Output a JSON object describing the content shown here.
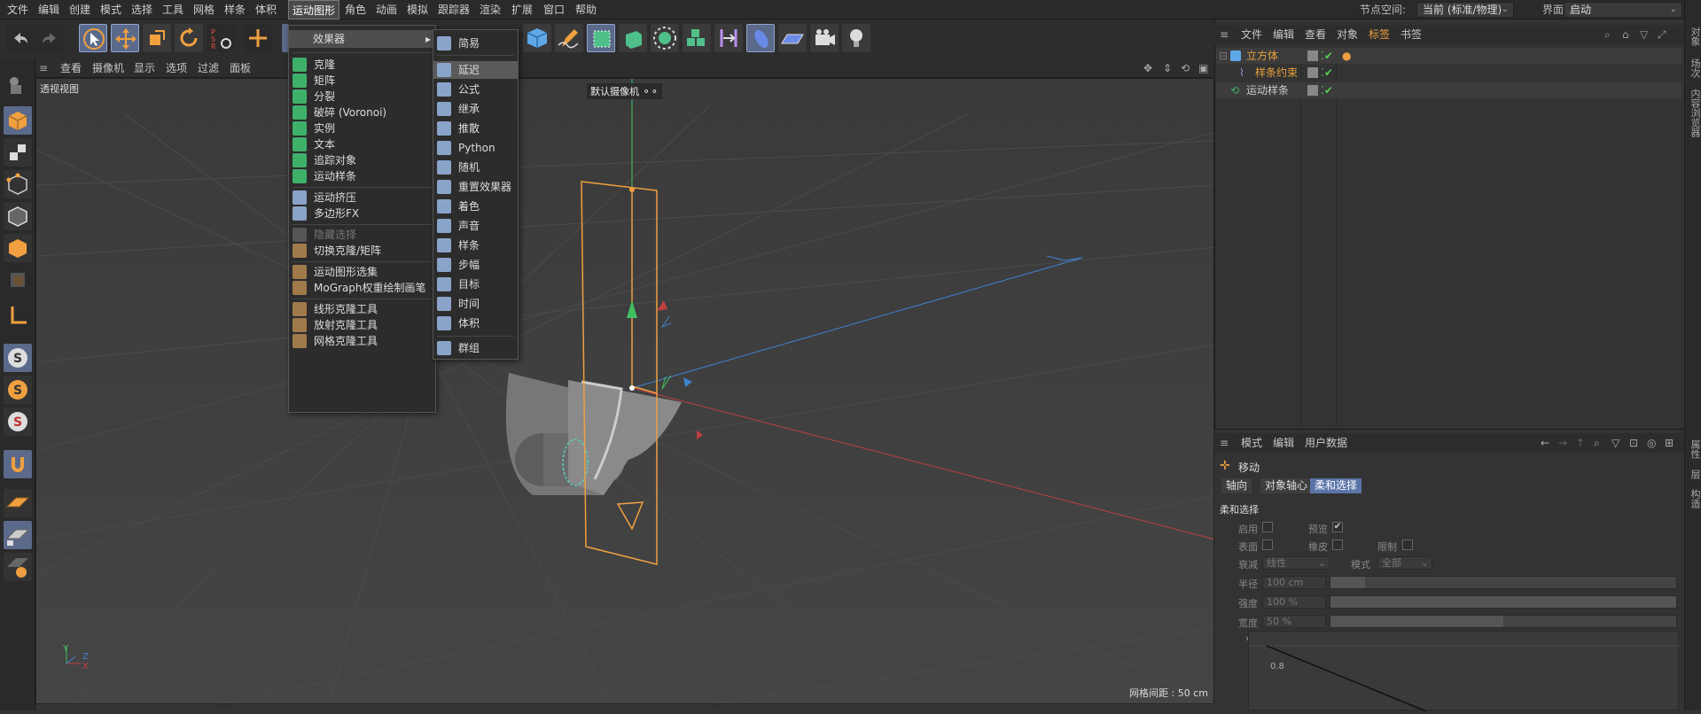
{
  "menubar": {
    "items": [
      "文件",
      "编辑",
      "创建",
      "模式",
      "选择",
      "工具",
      "网格",
      "样条",
      "体积",
      "运动图形",
      "角色",
      "动画",
      "模拟",
      "跟踪器",
      "渲染",
      "扩展",
      "窗口",
      "帮助"
    ],
    "node_space_label": "节点空间:",
    "node_space_value": "当前 (标准/物理)",
    "interface_label": "界面:",
    "interface_value": "启动"
  },
  "viewport": {
    "menu": [
      "查看",
      "摄像机",
      "显示",
      "选项",
      "过滤",
      "面板"
    ],
    "label": "透视视图",
    "camera": "默认摄像机",
    "grid_info": "网格间距 : 50 cm",
    "axis_y": "Y",
    "axis_z": "Z",
    "axis_x": "X"
  },
  "mograph_menu": {
    "effectors_label": "效果器",
    "items": [
      {
        "label": "克隆",
        "icon": "cloner-icon",
        "color": "#3fb06a"
      },
      {
        "label": "矩阵",
        "icon": "matrix-icon",
        "color": "#3fb06a"
      },
      {
        "label": "分裂",
        "icon": "fracture-icon",
        "color": "#3fb06a"
      },
      {
        "label": "破碎 (Voronoi)",
        "icon": "voronoi-icon",
        "color": "#3fb06a"
      },
      {
        "label": "实例",
        "icon": "instance-icon",
        "color": "#3fb06a"
      },
      {
        "label": "文本",
        "icon": "text-icon",
        "color": "#3fb06a"
      },
      {
        "label": "追踪对象",
        "icon": "tracer-icon",
        "color": "#3fb06a"
      },
      {
        "label": "运动样条",
        "icon": "motion-spline-icon",
        "color": "#3fb06a"
      },
      {
        "label": "运动挤压",
        "icon": "extrude-icon",
        "color": "#8aa3c8"
      },
      {
        "label": "多边形FX",
        "icon": "polyfx-icon",
        "color": "#8aa3c8"
      },
      {
        "label": "隐藏选择",
        "icon": "hide-selection-icon",
        "color": "#555"
      },
      {
        "label": "切换克隆/矩阵",
        "icon": "toggle-clone-icon",
        "color": "#a07a4a"
      },
      {
        "label": "运动图形选集",
        "icon": "selection-icon",
        "color": "#a07a4a"
      },
      {
        "label": "MoGraph权重绘制画笔",
        "icon": "weight-brush-icon",
        "color": "#a07a4a"
      },
      {
        "label": "线形克隆工具",
        "icon": "linear-clone-icon",
        "color": "#a07a4a"
      },
      {
        "label": "放射克隆工具",
        "icon": "radial-clone-icon",
        "color": "#a07a4a"
      },
      {
        "label": "网格克隆工具",
        "icon": "grid-clone-icon",
        "color": "#a07a4a"
      }
    ]
  },
  "effectors_submenu": {
    "items": [
      "简易",
      "延迟",
      "公式",
      "继承",
      "推散",
      "Python",
      "随机",
      "重置效果器",
      "着色",
      "声音",
      "样条",
      "步幅",
      "目标",
      "时间",
      "体积",
      "群组"
    ]
  },
  "object_manager": {
    "menu": [
      "文件",
      "编辑",
      "查看",
      "对象",
      "标签",
      "书签"
    ],
    "objects": [
      {
        "name": "立方体",
        "color": "#e8a13c"
      },
      {
        "name": "样条约束",
        "color": "#e8a13c"
      },
      {
        "name": "运动样条",
        "color": "#c8c8c8"
      }
    ]
  },
  "attributes": {
    "menu": [
      "模式",
      "编辑",
      "用户数据"
    ],
    "tool_name": "移动",
    "tabs": [
      "轴向",
      "对象轴心",
      "柔和选择"
    ],
    "section": "柔和选择",
    "enable_label": "启用",
    "preview_label": "预览",
    "surface_label": "表面",
    "rubber_label": "橡皮",
    "restrict_label": "限制",
    "falloff_label": "衰减",
    "falloff_value": "线性",
    "mode_label": "模式",
    "mode_value": "全部",
    "radius_label": "半径",
    "radius_value": "100 cm",
    "strength_label": "强度",
    "strength_value": "100 %",
    "width_label": "宽度",
    "width_value": "50 %",
    "graph_tick": "0.8",
    "radius_fraction": 0.1,
    "strength_fraction": 1.0,
    "width_fraction": 0.5
  },
  "right_strip": [
    "对象",
    "场次",
    "内容浏览器",
    "属性",
    "层",
    "构造"
  ]
}
